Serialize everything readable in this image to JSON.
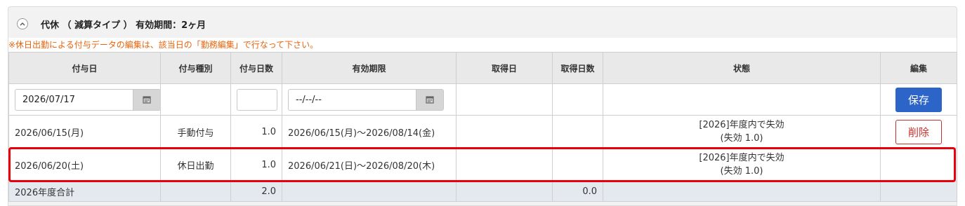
{
  "section": {
    "title": "代休 （ 減算タイプ ） 有効期間：2ヶ月",
    "notice": "※休日出勤による付与データの編集は、該当日の「勤務編集」で行なって下さい。"
  },
  "columns": [
    "付与日",
    "付与種別",
    "付与日数",
    "有効期限",
    "取得日",
    "取得日数",
    "状態",
    "編集"
  ],
  "input_row": {
    "grant_date_value": "2026/07/17",
    "expiry_date_value": "--/--/--",
    "save_label": "保存"
  },
  "rows": [
    {
      "grant_date": "2026/06/15(月)",
      "grant_type": "手動付与",
      "grant_days": "1.0",
      "expiry": "2026/06/15(月)～2026/08/14(金)",
      "taken_date": "",
      "taken_days": "",
      "status_line1": "[2026]年度内で失効",
      "status_line2": "(失効 1.0)",
      "delete_label": "削除"
    },
    {
      "grant_date": "2026/06/20(土)",
      "grant_type": "休日出勤",
      "grant_days": "1.0",
      "expiry": "2026/06/21(日)～2026/08/20(木)",
      "taken_date": "",
      "taken_days": "",
      "status_line1": "[2026]年度内で失効",
      "status_line2": "(失効 1.0)"
    }
  ],
  "total": {
    "label": "2026年度合計",
    "grant_days": "2.0",
    "taken_days": "0.0"
  },
  "colors": {
    "save_button": "#2c64c8",
    "delete_button": "#c9302c",
    "notice_text": "#e8640a",
    "highlight_border": "#e8000b"
  },
  "icons": {
    "collapse": "chevron-up-icon",
    "calendar": "calendar-icon"
  }
}
